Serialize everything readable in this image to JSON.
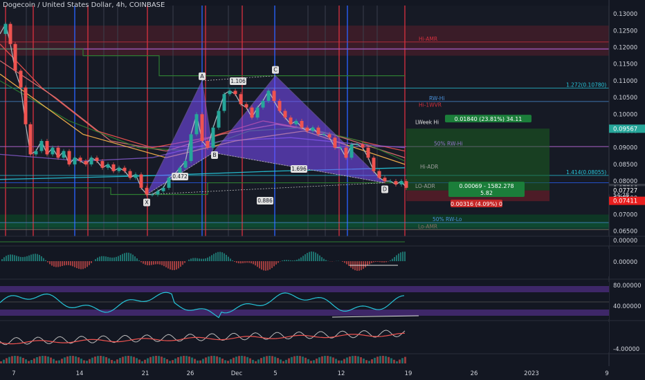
{
  "header": {
    "title": "Dogecoin / United States Dollar, 4h, COINBASE"
  },
  "chart_data": {
    "type": "line",
    "title": "Dogecoin / United States Dollar, 4h, COINBASE",
    "xlabel": "",
    "ylabel": "",
    "x_ticks": [
      "7",
      "14",
      "21",
      "26",
      "Dec",
      "5",
      "12",
      "19",
      "26",
      "2023",
      "9"
    ],
    "y_ticks": [
      "0.13000",
      "0.12500",
      "0.12000",
      "0.11500",
      "0.11000",
      "0.10500",
      "0.10000",
      "0.09500",
      "0.09000",
      "0.08500",
      "0.08000",
      "0.07500",
      "0.07000",
      "0.06500"
    ],
    "ylim": [
      0.0635,
      0.1325
    ],
    "price_labels": [
      {
        "value": 0.09567,
        "text": "0.09567",
        "color": "#26a69a"
      },
      {
        "value": 0.07796,
        "text": "0.07796",
        "color": "#363a45"
      },
      {
        "value": 0.07727,
        "text": "0.07727",
        "color": "#131722"
      },
      {
        "value": 0.07411,
        "text": "0.07411",
        "color": "#e91e1e"
      }
    ],
    "countdown": "54:28",
    "price_series": {
      "x": [
        0,
        8,
        15,
        22,
        30,
        37,
        44,
        52,
        60,
        68,
        76,
        84,
        92,
        100,
        108,
        116,
        124,
        132,
        140,
        148,
        156,
        164,
        172,
        180,
        188,
        196,
        204,
        212,
        220,
        228,
        236,
        244,
        252,
        260,
        268,
        276,
        284,
        292,
        300,
        308,
        316,
        324,
        332,
        340,
        348,
        356,
        364,
        372,
        380,
        388,
        396,
        404,
        412,
        420,
        428,
        436,
        444,
        452,
        460,
        468,
        476,
        484,
        492,
        500,
        508,
        516,
        524,
        532,
        540,
        548,
        556,
        564,
        572,
        580,
        587
      ],
      "y": [
        0.124,
        0.127,
        0.121,
        0.113,
        0.108,
        0.097,
        0.088,
        0.089,
        0.092,
        0.088,
        0.09,
        0.087,
        0.089,
        0.085,
        0.087,
        0.086,
        0.085,
        0.087,
        0.086,
        0.084,
        0.085,
        0.083,
        0.084,
        0.083,
        0.081,
        0.082,
        0.078,
        0.076,
        0.076,
        0.077,
        0.078,
        0.081,
        0.082,
        0.084,
        0.086,
        0.094,
        0.1,
        0.092,
        0.09,
        0.096,
        0.101,
        0.106,
        0.107,
        0.106,
        0.103,
        0.102,
        0.099,
        0.102,
        0.104,
        0.107,
        0.104,
        0.101,
        0.099,
        0.097,
        0.098,
        0.096,
        0.095,
        0.096,
        0.094,
        0.094,
        0.093,
        0.09,
        0.09,
        0.087,
        0.091,
        0.091,
        0.09,
        0.087,
        0.083,
        0.081,
        0.08,
        0.08,
        0.079,
        0.08,
        0.078
      ]
    },
    "xabcd_pattern": {
      "points": [
        {
          "label": "X",
          "date_index": 212,
          "value": 0.076
        },
        {
          "label": "A",
          "date_index": 292,
          "value": 0.11
        },
        {
          "label": "B",
          "date_index": 308,
          "value": 0.0885
        },
        {
          "label": "C",
          "date_index": 398,
          "value": 0.1115
        },
        {
          "label": "D",
          "date_index": 556,
          "value": 0.0795
        }
      ],
      "ratios": [
        "0.472",
        "1.106",
        "1.696",
        "0.886"
      ]
    },
    "level_labels": [
      {
        "text": "1.272(0.10780)",
        "value": 0.1078
      },
      {
        "text": "RW-Hi",
        "value": 0.1038
      },
      {
        "text": "Hi-1WVR",
        "value": 0.1018
      },
      {
        "text": "LWeek Hi",
        "value": 0.0967
      },
      {
        "text": "50% RW-Hi",
        "value": 0.0903
      },
      {
        "text": "Hi-ADR",
        "value": 0.0833
      },
      {
        "text": "1.414(0.08055)",
        "value": 0.0817
      },
      {
        "text": "LO-ADR",
        "value": 0.0775
      },
      {
        "text": "50% RW-Lo",
        "value": 0.0676
      },
      {
        "text": "Lo-AMR",
        "value": 0.0655
      },
      {
        "text": "Hi-AMR",
        "value": 0.1216
      }
    ],
    "position_tool": {
      "target_text": "0.01840 (23.81%) 34.11",
      "current_text": "0.00069 - 1582.278",
      "current_sub": "5.82",
      "stop_text": "0.00316 (4.09%) 0",
      "target_value": 0.0957,
      "entry_value": 0.0772,
      "stop_value": 0.074
    },
    "indicator_panels": [
      {
        "name": "histogram",
        "ticks": [
          "0.00000",
          "0.00000"
        ]
      },
      {
        "name": "oscillator",
        "ticks": [
          "80.00000",
          "40.00000"
        ]
      },
      {
        "name": "momentum",
        "ticks": [
          "-4.00000"
        ]
      }
    ]
  }
}
